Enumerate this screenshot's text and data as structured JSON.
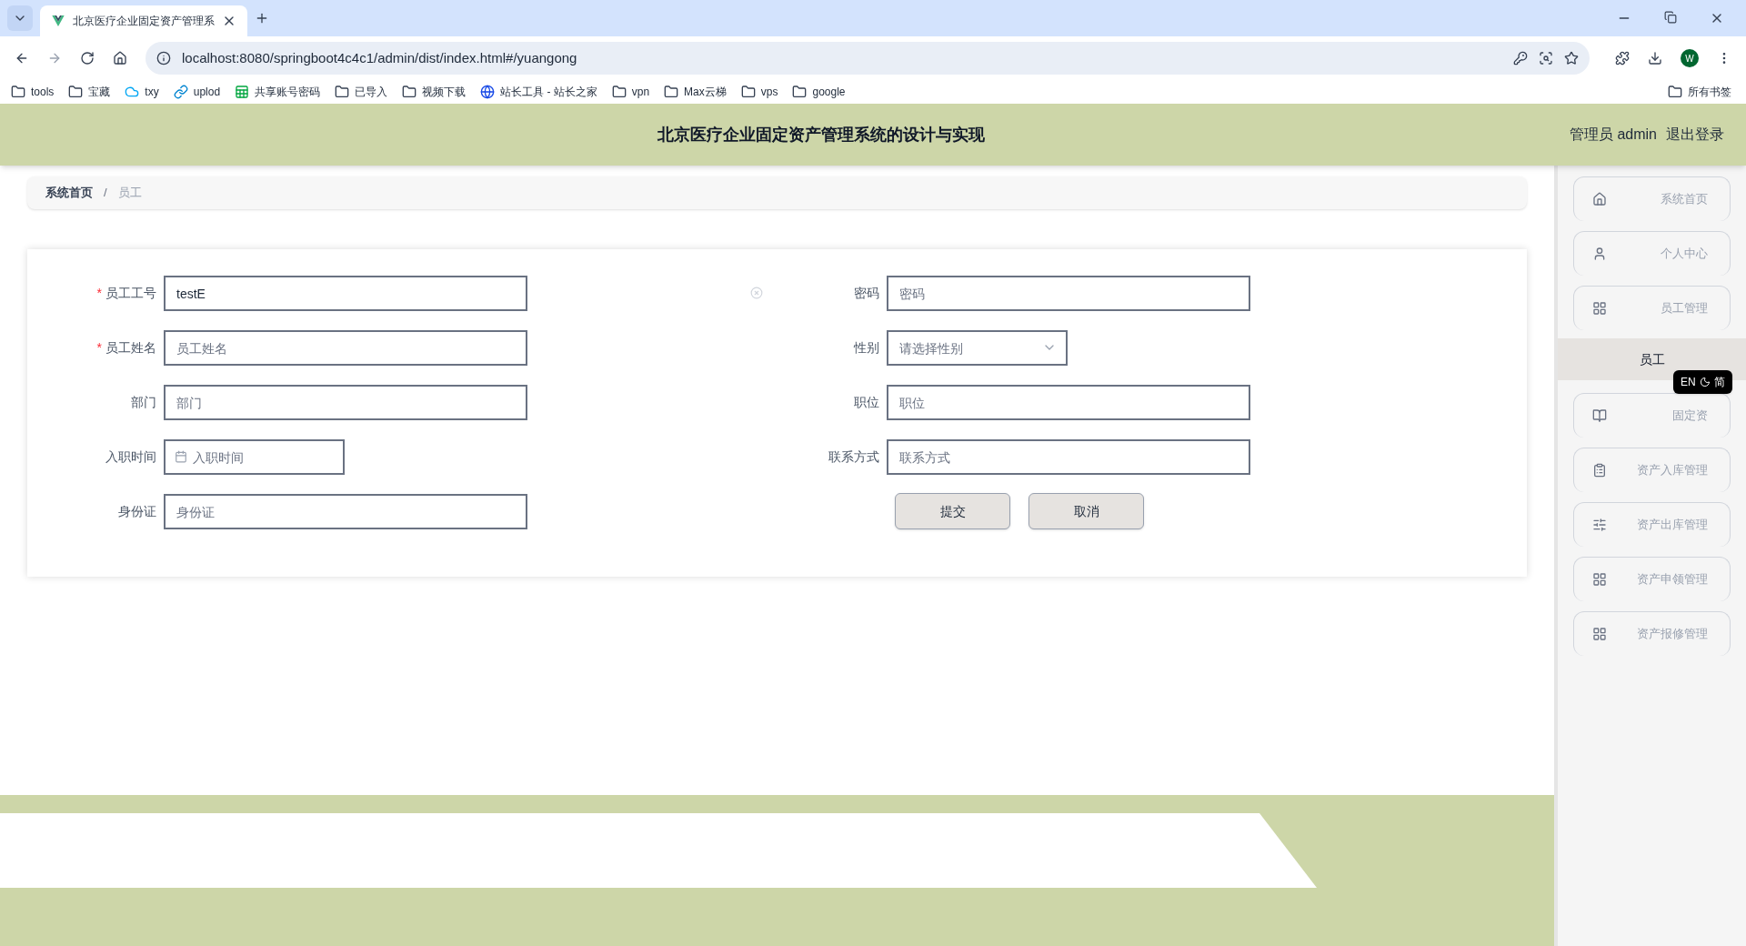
{
  "browser": {
    "tab_title": "北京医疗企业固定资产管理系",
    "url": "localhost:8080/springboot4c4c1/admin/dist/index.html#/yuangong",
    "bookmarks": [
      {
        "label": "tools",
        "kind": "folder"
      },
      {
        "label": "宝藏",
        "kind": "folder"
      },
      {
        "label": "txy",
        "kind": "cloud"
      },
      {
        "label": "uplod",
        "kind": "link"
      },
      {
        "label": "共享账号密码",
        "kind": "sheet"
      },
      {
        "label": "已导入",
        "kind": "folder"
      },
      {
        "label": "视频下载",
        "kind": "folder"
      },
      {
        "label": "站长工具 - 站长之家",
        "kind": "site"
      },
      {
        "label": "vpn",
        "kind": "folder"
      },
      {
        "label": "Max云梯",
        "kind": "folder"
      },
      {
        "label": "vps",
        "kind": "folder"
      },
      {
        "label": "google",
        "kind": "folder"
      }
    ],
    "all_bookmarks": "所有书签",
    "profile": "W"
  },
  "header": {
    "title": "北京医疗企业固定资产管理系统的设计与实现",
    "user": "管理员 admin",
    "logout": "退出登录"
  },
  "breadcrumb": [
    "系统首页",
    "员工"
  ],
  "breadcrumb_separator": "/",
  "form": {
    "required_mark": "*",
    "left": [
      {
        "label": "员工工号",
        "required": true,
        "kind": "text",
        "value": "testE"
      },
      {
        "label": "员工姓名",
        "required": true,
        "kind": "text",
        "placeholder": "员工姓名"
      },
      {
        "label": "部门",
        "required": false,
        "kind": "text",
        "placeholder": "部门"
      },
      {
        "label": "入职时间",
        "required": false,
        "kind": "date",
        "placeholder": "入职时间"
      },
      {
        "label": "身份证",
        "required": false,
        "kind": "text",
        "placeholder": "身份证"
      }
    ],
    "right": [
      {
        "label": "密码",
        "required": false,
        "kind": "text",
        "placeholder": "密码"
      },
      {
        "label": "性别",
        "required": false,
        "kind": "select",
        "placeholder": "请选择性别"
      },
      {
        "label": "职位",
        "required": false,
        "kind": "text",
        "placeholder": "职位"
      },
      {
        "label": "联系方式",
        "required": false,
        "kind": "text",
        "placeholder": "联系方式"
      }
    ],
    "buttons": [
      "提交",
      "取消"
    ]
  },
  "sidebar": [
    {
      "label": "系统首页",
      "kind": "menu"
    },
    {
      "label": "个人中心",
      "kind": "menu"
    },
    {
      "label": "员工管理",
      "kind": "menu"
    },
    {
      "label": "员工",
      "kind": "sub",
      "selected": true
    },
    {
      "label": "固定资",
      "kind": "menu"
    },
    {
      "label": "资产入库管理",
      "kind": "menu"
    },
    {
      "label": "资产出库管理",
      "kind": "menu"
    },
    {
      "label": "资产申领管理",
      "kind": "menu"
    },
    {
      "label": "资产报修管理",
      "kind": "menu"
    }
  ],
  "translate_widget": {
    "lang": "EN",
    "target": "简"
  }
}
